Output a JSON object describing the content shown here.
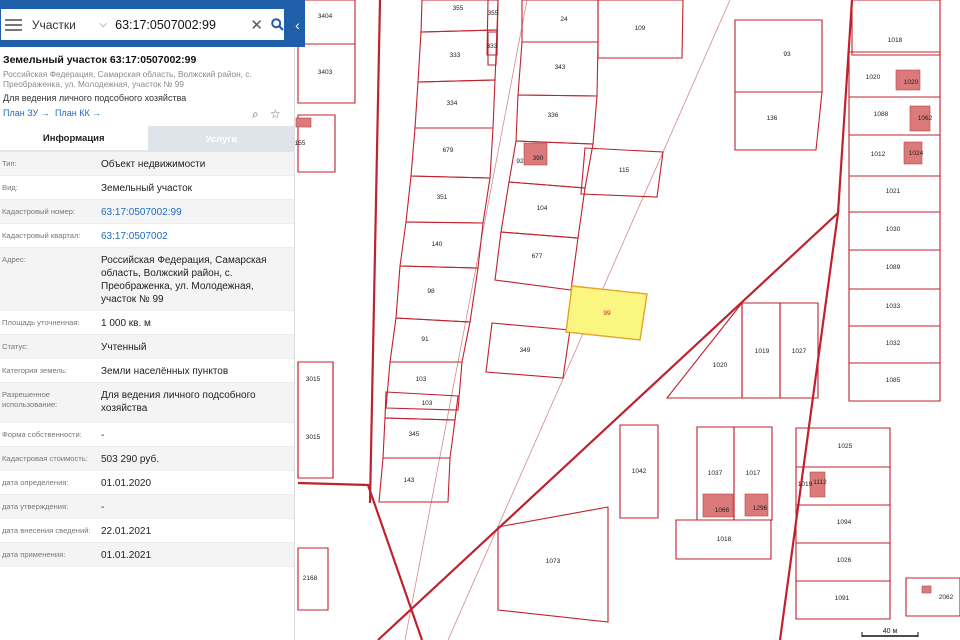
{
  "search": {
    "type_label": "Участки",
    "value": "63:17:0507002:99"
  },
  "panel": {
    "title": "Земельный участок 63:17:0507002:99",
    "address": "Российская Федерация, Самарская область, Волжский район, с. Преображенка, ул. Молодежная, участок № 99",
    "use": "Для ведения личного подсобного хозяйства",
    "link_plan_zu": "План ЗУ →",
    "link_plan_kk": "План КК →"
  },
  "tabs": {
    "info": "Информация",
    "services": "Услуги"
  },
  "details": {
    "type_label": "Тип:",
    "type_value": "Объект недвижимости",
    "kind_label": "Вид:",
    "kind_value": "Земельный участок",
    "cadnum_label": "Кадастровый номер:",
    "cadnum_value": "63:17:0507002:99",
    "quarter_label": "Кадастровый квартал:",
    "quarter_value": "63:17:0507002",
    "address_label": "Адрес:",
    "address_value": "Российская Федерация, Самарская область, Волжский район, с. Преображенка, ул. Молодежная, участок № 99",
    "area_label": "Площадь уточненная:",
    "area_value": "1 000 кв. м",
    "status_label": "Статус:",
    "status_value": "Учтенный",
    "category_label": "Категория земель:",
    "category_value": "Земли населённых пунктов",
    "permitted_label": "Разрешенное использование:",
    "permitted_value": "Для ведения личного подсобного хозяйства",
    "ownership_label": "Форма собственности:",
    "ownership_value": "-",
    "cost_label": "Кадастровая стоимость:",
    "cost_value": "503 290 руб.",
    "date_def_label": "дата определения:",
    "date_def_value": "01.01.2020",
    "date_appr_label": "дата утверждения:",
    "date_appr_value": "-",
    "date_entry_label": "дата внесения сведений:",
    "date_entry_value": "22.01.2021",
    "date_apply_label": "дата применения:",
    "date_apply_value": "01.01.2021"
  },
  "map": {
    "scale_label": "40 м",
    "selected_parcel": "99",
    "colors": {
      "boundary": "#c0212e",
      "selected_fill": "#fbf67f",
      "building": "#db7a7a"
    },
    "parcel_labels": [
      "3404",
      "3403",
      "155",
      "3015",
      "3015",
      "2168",
      "355",
      "355",
      "333",
      "333",
      "334",
      "679",
      "351",
      "140",
      "98",
      "91",
      "103",
      "103",
      "345",
      "143",
      "24",
      "109",
      "343",
      "336",
      "92",
      "390",
      "104",
      "677",
      "115",
      "349",
      "93",
      "136",
      "99",
      "1018",
      "1020",
      "1020",
      "1088",
      "1062",
      "1012",
      "1024",
      "1021",
      "1030",
      "1089",
      "1033",
      "1032",
      "1085",
      "1020",
      "1019",
      "1027",
      "1042",
      "1037",
      "1017",
      "1066",
      "1296",
      "1018",
      "1025",
      "1019",
      "1112",
      "1094",
      "1026",
      "1091",
      "1073",
      "2062"
    ]
  }
}
